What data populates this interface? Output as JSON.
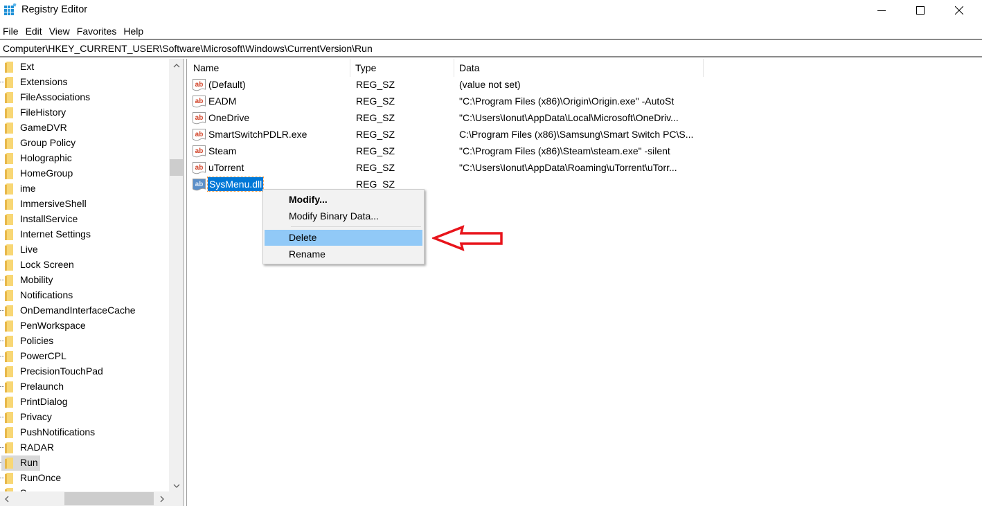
{
  "window": {
    "title": "Registry Editor",
    "icons": {
      "app": "registry-editor-icon",
      "minimize": "minimize-icon",
      "maximize": "maximize-icon",
      "close": "close-icon"
    }
  },
  "menu": [
    "File",
    "Edit",
    "View",
    "Favorites",
    "Help"
  ],
  "address": "Computer\\HKEY_CURRENT_USER\\Software\\Microsoft\\Windows\\CurrentVersion\\Run",
  "tree": {
    "items": [
      {
        "label": "Ext",
        "dots": false
      },
      {
        "label": "Extensions",
        "dots": true
      },
      {
        "label": "FileAssociations",
        "dots": false
      },
      {
        "label": "FileHistory",
        "dots": false
      },
      {
        "label": "GameDVR",
        "dots": false
      },
      {
        "label": "Group Policy",
        "dots": false
      },
      {
        "label": "Holographic",
        "dots": false
      },
      {
        "label": "HomeGroup",
        "dots": false
      },
      {
        "label": "ime",
        "dots": false
      },
      {
        "label": "ImmersiveShell",
        "dots": false
      },
      {
        "label": "InstallService",
        "dots": false
      },
      {
        "label": "Internet Settings",
        "dots": false
      },
      {
        "label": "Live",
        "dots": false
      },
      {
        "label": "Lock Screen",
        "dots": false
      },
      {
        "label": "Mobility",
        "dots": true
      },
      {
        "label": "Notifications",
        "dots": false
      },
      {
        "label": "OnDemandInterfaceCache",
        "dots": true
      },
      {
        "label": "PenWorkspace",
        "dots": false
      },
      {
        "label": "Policies",
        "dots": true
      },
      {
        "label": "PowerCPL",
        "dots": true
      },
      {
        "label": "PrecisionTouchPad",
        "dots": false
      },
      {
        "label": "Prelaunch",
        "dots": true
      },
      {
        "label": "PrintDialog",
        "dots": false
      },
      {
        "label": "Privacy",
        "dots": true
      },
      {
        "label": "PushNotifications",
        "dots": false
      },
      {
        "label": "RADAR",
        "dots": true
      },
      {
        "label": "Run",
        "dots": true,
        "selected": true
      },
      {
        "label": "RunOnce",
        "dots": true
      },
      {
        "label": "S...",
        "dots": false
      }
    ]
  },
  "list": {
    "columns": {
      "name": "Name",
      "type": "Type",
      "data": "Data"
    },
    "rows": [
      {
        "name": "(Default)",
        "type": "REG_SZ",
        "data": "(value not set)"
      },
      {
        "name": "EADM",
        "type": "REG_SZ",
        "data": "\"C:\\Program Files (x86)\\Origin\\Origin.exe\" -AutoSt"
      },
      {
        "name": "OneDrive",
        "type": "REG_SZ",
        "data": "\"C:\\Users\\Ionut\\AppData\\Local\\Microsoft\\OneDriv..."
      },
      {
        "name": "SmartSwitchPDLR.exe",
        "type": "REG_SZ",
        "data": "C:\\Program Files (x86)\\Samsung\\Smart Switch PC\\S..."
      },
      {
        "name": "Steam",
        "type": "REG_SZ",
        "data": "\"C:\\Program Files (x86)\\Steam\\steam.exe\" -silent"
      },
      {
        "name": "uTorrent",
        "type": "REG_SZ",
        "data": "\"C:\\Users\\Ionut\\AppData\\Roaming\\uTorrent\\uTorr..."
      },
      {
        "name": "SysMenu.dll",
        "type": "REG_SZ",
        "data": "",
        "selected": true
      }
    ]
  },
  "context_menu": {
    "items": [
      {
        "label": "Modify...",
        "bold": true
      },
      {
        "label": "Modify Binary Data..."
      },
      {
        "label": "Delete",
        "highlighted": true
      },
      {
        "label": "Rename"
      }
    ]
  },
  "annotation": {
    "type": "arrow-pointing-left",
    "color": "#e8141b"
  },
  "colors": {
    "selection": "#0078d7",
    "menu_highlight": "#91c9f7",
    "tree_selection": "#d9d9d9",
    "folder": "#f8d775"
  }
}
